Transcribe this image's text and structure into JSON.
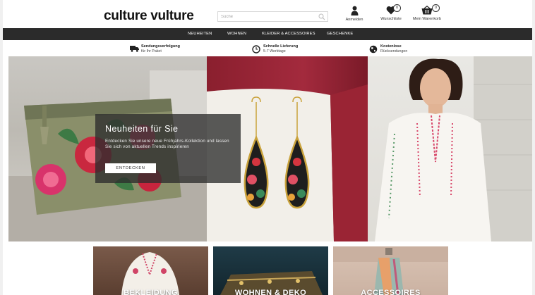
{
  "header": {
    "logo": "culture vulture",
    "search": {
      "placeholder": "Suche",
      "icon": "search-icon"
    },
    "account": {
      "label": "Anmelden",
      "icon": "user-icon"
    },
    "wishlist": {
      "label": "Wunschliste",
      "count": "0",
      "icon": "heart-icon"
    },
    "cart": {
      "label": "Mein Warenkorb",
      "count": "0",
      "icon": "basket-icon"
    }
  },
  "nav": {
    "items": [
      {
        "label": "NEUHEITEN"
      },
      {
        "label": "WOHNEN"
      },
      {
        "label": "KLEIDER & ACCESSOIRES"
      },
      {
        "label": "GESCHENKE"
      }
    ]
  },
  "usps": [
    {
      "title": "Sendungsverfolgung",
      "subtitle": "für Ihr Paket",
      "icon": "truck-icon"
    },
    {
      "title": "Schnelle Lieferung",
      "subtitle": "5-7 Werktage",
      "icon": "clock-icon"
    },
    {
      "title": "Kostenlose",
      "subtitle": "Rücksendungen",
      "icon": "globe-icon"
    }
  ],
  "hero": {
    "headline": "Neuheiten für Sie",
    "text": "Entdecken Sie unsere neue Frühjahrs-Kollektion und lassen Sie sich von aktuellen Trends inspirieren",
    "button": "ENTDECKEN"
  },
  "categories": [
    {
      "label": "BEKLEIDUNG"
    },
    {
      "label": "WOHNEN & DEKO"
    },
    {
      "label": "ACCESSOIRES"
    }
  ],
  "colors": {
    "nav_bg": "#2b2b2b",
    "promo_overlay": "#2d2d2d",
    "text": "#111111",
    "page_bg": "#ffffff",
    "outer_bg": "#f0f0f0"
  }
}
